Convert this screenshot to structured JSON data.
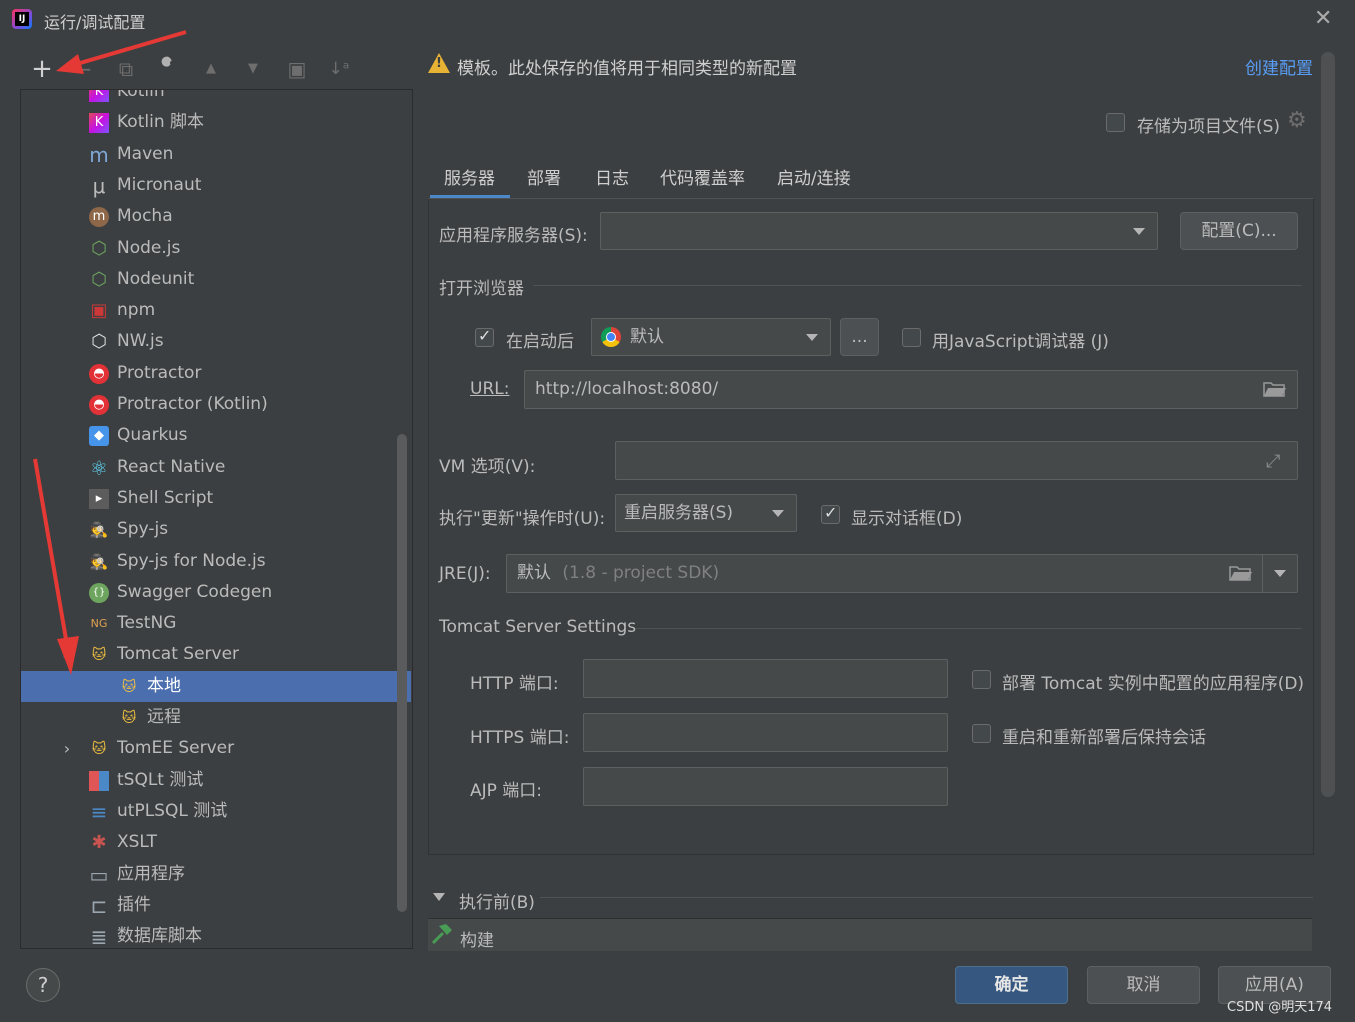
{
  "window": {
    "title": "运行/调试配置",
    "close": "✕"
  },
  "toolbar": {
    "add": "+",
    "remove": "−",
    "copy": "⧉",
    "edit": "🔧",
    "up": "▲",
    "down": "▼",
    "folder": "▣",
    "sort": "↓ᵃ"
  },
  "tree": {
    "items": [
      {
        "label": "Kotlin",
        "icon": "kotlin-icon",
        "indent": 1
      },
      {
        "label": "Kotlin 脚本",
        "icon": "kotlin-icon",
        "indent": 1
      },
      {
        "label": "Maven",
        "icon": "maven-icon",
        "indent": 1
      },
      {
        "label": "Micronaut",
        "icon": "micronaut-icon",
        "indent": 1
      },
      {
        "label": "Mocha",
        "icon": "mocha-icon",
        "indent": 1
      },
      {
        "label": "Node.js",
        "icon": "nodejs-icon",
        "indent": 1
      },
      {
        "label": "Nodeunit",
        "icon": "nodeunit-icon",
        "indent": 1
      },
      {
        "label": "npm",
        "icon": "npm-icon",
        "indent": 1
      },
      {
        "label": "NW.js",
        "icon": "nwjs-icon",
        "indent": 1
      },
      {
        "label": "Protractor",
        "icon": "protractor-icon",
        "indent": 1
      },
      {
        "label": "Protractor (Kotlin)",
        "icon": "protractor-icon",
        "indent": 1
      },
      {
        "label": "Quarkus",
        "icon": "quarkus-icon",
        "indent": 1
      },
      {
        "label": "React Native",
        "icon": "react-icon",
        "indent": 1
      },
      {
        "label": "Shell Script",
        "icon": "shell-icon",
        "indent": 1
      },
      {
        "label": "Spy-js",
        "icon": "spyjs-icon",
        "indent": 1
      },
      {
        "label": "Spy-js for Node.js",
        "icon": "spyjs-node-icon",
        "indent": 1
      },
      {
        "label": "Swagger Codegen",
        "icon": "swagger-icon",
        "indent": 1
      },
      {
        "label": "TestNG",
        "icon": "testng-icon",
        "indent": 1
      },
      {
        "label": "Tomcat Server",
        "icon": "tomcat-icon",
        "indent": 1,
        "expanded": true
      },
      {
        "label": "本地",
        "icon": "tomcat-icon",
        "indent": 2,
        "selected": true
      },
      {
        "label": "远程",
        "icon": "tomcat-icon",
        "indent": 2
      },
      {
        "label": "TomEE Server",
        "icon": "tomee-icon",
        "indent": 1,
        "collapsed": true
      },
      {
        "label": "tSQLt 测试",
        "icon": "tsqlt-icon",
        "indent": 1
      },
      {
        "label": "utPLSQL 测试",
        "icon": "utplsql-icon",
        "indent": 1
      },
      {
        "label": "XSLT",
        "icon": "xslt-icon",
        "indent": 1
      },
      {
        "label": "应用程序",
        "icon": "application-icon",
        "indent": 1
      },
      {
        "label": "插件",
        "icon": "plugin-icon",
        "indent": 1
      },
      {
        "label": "数据库脚本",
        "icon": "database-script-icon",
        "indent": 1
      }
    ]
  },
  "header": {
    "warning": "模板。此处保存的值将用于相同类型的新配置",
    "create_link": "创建配置",
    "store_as_file": "存储为项目文件(S)"
  },
  "tabs": [
    "服务器",
    "部署",
    "日志",
    "代码覆盖率",
    "启动/连接"
  ],
  "server": {
    "app_server_label": "应用程序服务器(S):",
    "app_server_value": "",
    "configure_button": "配置(C)...",
    "open_browser_label": "打开浏览器",
    "after_launch_label": "在启动后",
    "browser_value": "默认",
    "browse_button": "...",
    "js_debugger_label": "用JavaScript调试器 (J)",
    "url_label": "URL:",
    "url_value": "http://localhost:8080/",
    "vm_label": "VM 选项(V):",
    "vm_value": "",
    "on_update_label": "执行\"更新\"操作时(U):",
    "on_update_value": "重启服务器(S)",
    "show_dialog_label": "显示对话框(D)",
    "jre_label": "JRE(J):",
    "jre_value": "默认",
    "jre_hint": "(1.8 - project SDK)",
    "tomcat_settings_label": "Tomcat Server Settings",
    "http_port_label": "HTTP 端口:",
    "https_port_label": "HTTPS 端口:",
    "ajp_port_label": "AJP 端口:",
    "deploy_apps_label": "部署 Tomcat 实例中配置的应用程序(D)",
    "preserve_sessions_label": "重启和重新部署后保持会话"
  },
  "before_launch": {
    "label": "执行前(B)",
    "item": "构建"
  },
  "footer": {
    "help": "?",
    "ok": "确定",
    "cancel": "取消",
    "apply": "应用(A)"
  },
  "watermark": "CSDN @明天174",
  "colors": {
    "accent": "#4b6eaf",
    "link": "#589df6",
    "warning": "#e8b234",
    "annotation": "#e53935"
  }
}
